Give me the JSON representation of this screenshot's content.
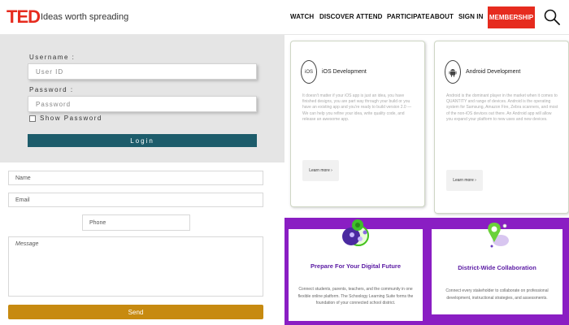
{
  "header": {
    "logo": "TED",
    "tagline": "Ideas worth spreading",
    "nav": [
      "WATCH",
      "DISCOVER",
      "ATTEND",
      "PARTICIPATE",
      "ABOUT",
      "SIGN IN"
    ],
    "membership_label": "MEMBERSHIP",
    "search_icon": "search-icon",
    "brand_color": "#e62b1e"
  },
  "login": {
    "username_label": "Username :",
    "username_placeholder": "User ID",
    "password_label": "Password :",
    "password_placeholder": "Password",
    "show_password_label": "Show Password",
    "login_label": "Login",
    "button_color": "#1d5c6b"
  },
  "contact": {
    "name_placeholder": "Name",
    "email_placeholder": "Email",
    "phone_placeholder": "Phone",
    "message_placeholder": "Message",
    "send_label": "Send",
    "send_color": "#c78a10"
  },
  "courses": [
    {
      "icon": "apple-icon",
      "icon_text": "iOS",
      "title": "iOS Development",
      "description": "It doesn't matter if your iOS app is just an idea, you have finished designs, you are part way through your build or you have an existing app and you're ready to build version 2.0 — We can help you refine your idea, write quality code, and release an awesome app.",
      "button": "Learn more ›"
    },
    {
      "icon": "android-icon",
      "title": "Android Development",
      "description": "Android is the dominant player in the market when it comes to QUANTITY and range of devices. Android is the operating system for Samsung, Amazon Fire, Zebra scanners, and most of the non-iOS devices out there. An Android app will allow you expand your platform to new uses and new devices.",
      "button": "Learn more ›"
    }
  ],
  "features": [
    {
      "icon": "people-network-icon",
      "title": "Prepare For Your Digital Future",
      "description": "Connect students, parents, teachers, and the community in one flexible online platform. The Schoology Learning Suite forms the foundation of your connected school district."
    },
    {
      "icon": "location-pin-icon",
      "title": "District-Wide Collaboration",
      "description": "Connect every stakeholder to collaborate on professional development, instructional strategies, and assessments."
    }
  ],
  "colors": {
    "purple_section": "#8a1ec3",
    "feature_title": "#5a1aa3"
  }
}
